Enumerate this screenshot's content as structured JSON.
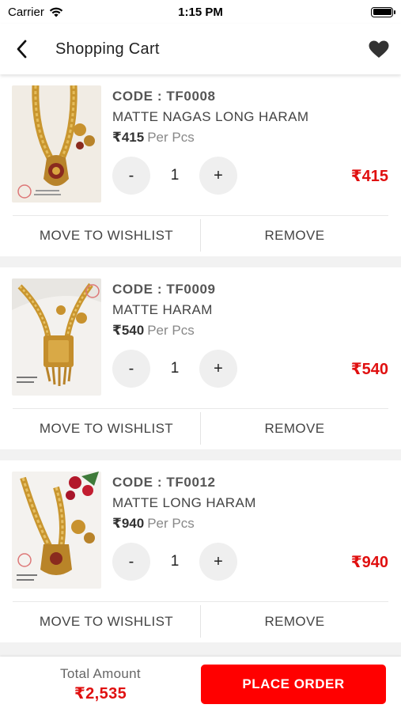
{
  "status_bar": {
    "carrier": "Carrier",
    "time": "1:15 PM"
  },
  "header": {
    "title": "Shopping Cart",
    "back_icon": "chevron-left-icon",
    "wishlist_icon": "heart-icon"
  },
  "cart_items": [
    {
      "code": "CODE : TF0008",
      "name": "MATTE NAGAS LONG HARAM",
      "price": "₹415",
      "unit": "Per Pcs",
      "quantity": "1",
      "line_total": "₹415",
      "minus_label": "-",
      "plus_label": "+",
      "wishlist_label": "MOVE TO WISHLIST",
      "remove_label": "REMOVE"
    },
    {
      "code": "CODE : TF0009",
      "name": "MATTE HARAM",
      "price": "₹540",
      "unit": "Per Pcs",
      "quantity": "1",
      "line_total": "₹540",
      "minus_label": "-",
      "plus_label": "+",
      "wishlist_label": "MOVE TO WISHLIST",
      "remove_label": "REMOVE"
    },
    {
      "code": "CODE : TF0012",
      "name": "MATTE LONG HARAM",
      "price": "₹940",
      "unit": "Per Pcs",
      "quantity": "1",
      "line_total": "₹940",
      "minus_label": "-",
      "plus_label": "+",
      "wishlist_label": "MOVE TO WISHLIST",
      "remove_label": "REMOVE"
    }
  ],
  "footer": {
    "total_label": "Total Amount",
    "total_value": "₹2,535",
    "place_order_label": "PLACE ORDER"
  },
  "colors": {
    "accent": "#ff0000",
    "price_red": "#e01010"
  }
}
